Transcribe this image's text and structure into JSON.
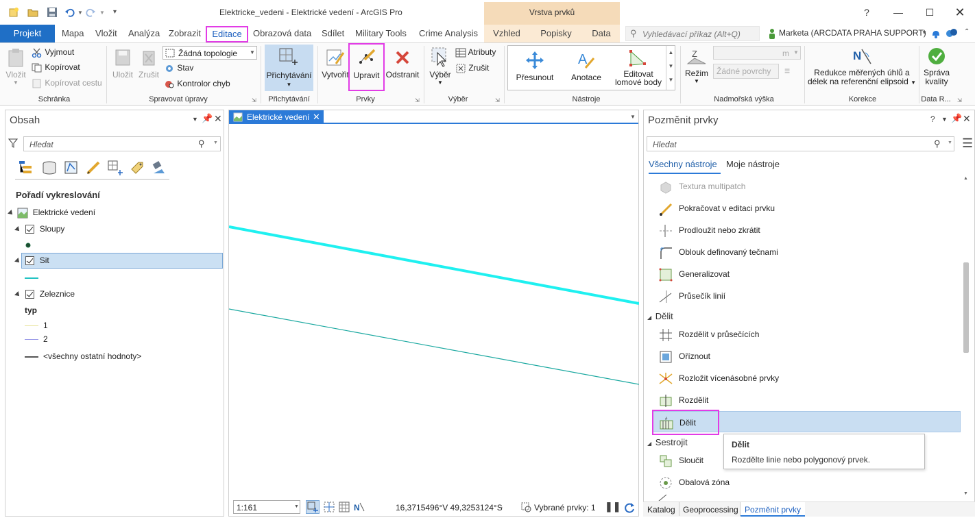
{
  "window": {
    "title": "Elektricke_vedeni - Elektrické vedení - ArcGIS Pro",
    "context_header": "Vrstva prvků",
    "help": "?"
  },
  "tabs": [
    {
      "label": "Projekt"
    },
    {
      "label": "Mapa"
    },
    {
      "label": "Vložit"
    },
    {
      "label": "Analýza"
    },
    {
      "label": "Zobrazit"
    },
    {
      "label": "Editace"
    },
    {
      "label": "Obrazová data"
    },
    {
      "label": "Sdílet"
    },
    {
      "label": "Military Tools"
    },
    {
      "label": "Crime Analysis"
    },
    {
      "label": "Vzhled"
    },
    {
      "label": "Popisky"
    },
    {
      "label": "Data"
    }
  ],
  "command_search": {
    "placeholder": "Vyhledávací příkaz (Alt+Q)"
  },
  "user": {
    "name": "Marketa (ARCDATA PRAHA SUPPORT)"
  },
  "ribbon": {
    "clipboard": {
      "label": "Schránka",
      "paste": "Vložit",
      "cut": "Vyjmout",
      "copy": "Kopírovat",
      "copy_path": "Kopírovat cestu"
    },
    "manage": {
      "label": "Spravovat úpravy",
      "save": "Uložit",
      "discard": "Zrušit",
      "topology": "Žádná topologie",
      "status": "Stav",
      "error_inspector": "Kontrolor chyb"
    },
    "snapping": {
      "label": "Přichytávání",
      "button": "Přichytávání"
    },
    "features": {
      "label": "Prvky",
      "create": "Vytvořit",
      "modify": "Upravit",
      "delete": "Odstranit"
    },
    "selection": {
      "label": "Výběr",
      "select": "Výběr",
      "attributes": "Atributy",
      "clear": "Zrušit"
    },
    "tools": {
      "label": "Nástroje",
      "move": "Přesunout",
      "annotation": "Anotace",
      "edit_vertices_1": "Editovat",
      "edit_vertices_2": "lomové body"
    },
    "elevation": {
      "label": "Nadmořská výška",
      "mode": "Režim",
      "unit": "m",
      "surface": "Žádné povrchy"
    },
    "corrections": {
      "label": "Korekce",
      "line1": "Redukce měřených úhlů a",
      "line2": "délek na referenční elipsoid"
    },
    "data_reviewer": {
      "label": "Data R...",
      "line1": "Správa",
      "line2": "kvality"
    }
  },
  "contents": {
    "title": "Obsah",
    "search_placeholder": "Hledat",
    "heading": "Pořadí vykreslování",
    "map_name": "Elektrické vedení",
    "layers": [
      {
        "name": "Sloupy"
      },
      {
        "name": "Sit"
      },
      {
        "name": "Zeleznice"
      }
    ],
    "legend_field": "typ",
    "legend_values": [
      "1",
      "2",
      "<všechny ostatní hodnoty>"
    ],
    "colors": {
      "sit": "#22c3c3",
      "rail1": "#e8e39a",
      "rail2": "#9a9ae8",
      "rail_other": "#555555"
    }
  },
  "map": {
    "tab_label": "Elektrické vedení",
    "scale": "1:161",
    "coordinates": "16,3715496°V 49,3253124°S",
    "selected_features": "Vybrané prvky: 1",
    "line_color_thick": "#1ff0f0",
    "line_color_thin": "#1aa8a0"
  },
  "modify_pane": {
    "title": "Pozměnit prvky",
    "search_placeholder": "Hledat",
    "tab_all": "Všechny nástroje",
    "tab_mine": "Moje nástroje",
    "tools_top": [
      {
        "label": "Textura multipatch",
        "disabled": true
      },
      {
        "label": "Pokračovat v editaci prvku"
      },
      {
        "label": "Prodloužit nebo zkrátit"
      },
      {
        "label": "Oblouk definovaný tečnami"
      },
      {
        "label": "Generalizovat"
      },
      {
        "label": "Průsečík linií"
      }
    ],
    "category_divide": "Dělit",
    "tools_divide": [
      {
        "label": "Rozdělit v průsečících"
      },
      {
        "label": "Oříznout"
      },
      {
        "label": "Rozložit vícenásobné prvky"
      },
      {
        "label": "Rozdělit"
      },
      {
        "label": "Dělit"
      }
    ],
    "category_construct": "Sestrojit",
    "tools_construct": [
      {
        "label": "Sloučit"
      },
      {
        "label": "Obalová zóna"
      }
    ],
    "tooltip_title": "Dělit",
    "tooltip_text": "Rozdělte linie nebo polygonový prvek.",
    "bottom_tabs": [
      "Katalog",
      "Geoprocessing",
      "Pozměnit prvky"
    ],
    "highlight_color": "#e23ce6"
  }
}
